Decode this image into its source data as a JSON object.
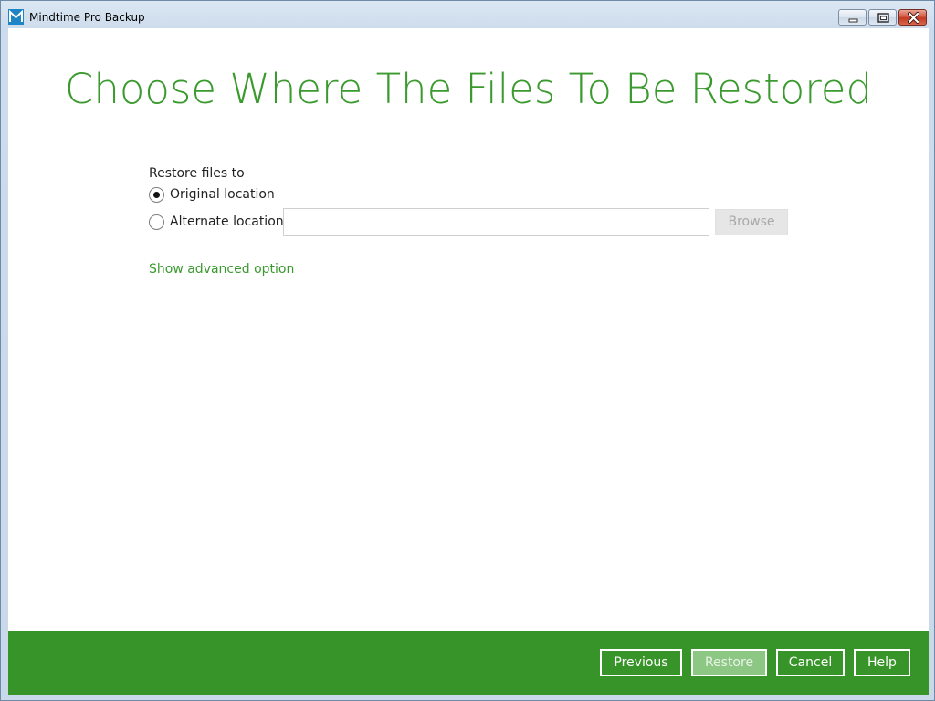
{
  "window": {
    "title": "Mindtime Pro Backup",
    "accent_color": "#3a9a2e",
    "footer_color": "#379428"
  },
  "page": {
    "heading": "Choose Where The Files To Be Restored"
  },
  "restore": {
    "section_label": "Restore files to",
    "options": [
      {
        "label": "Original location",
        "selected": true
      },
      {
        "label": "Alternate location",
        "selected": false
      }
    ],
    "alternate_path_value": "",
    "browse_label": "Browse",
    "advanced_link": "Show advanced option"
  },
  "footer": {
    "previous_label": "Previous",
    "restore_label": "Restore",
    "cancel_label": "Cancel",
    "help_label": "Help"
  },
  "icons": {
    "app": "app-logo-icon",
    "minimize": "minimize-icon",
    "maximize": "maximize-icon",
    "close": "close-icon"
  }
}
